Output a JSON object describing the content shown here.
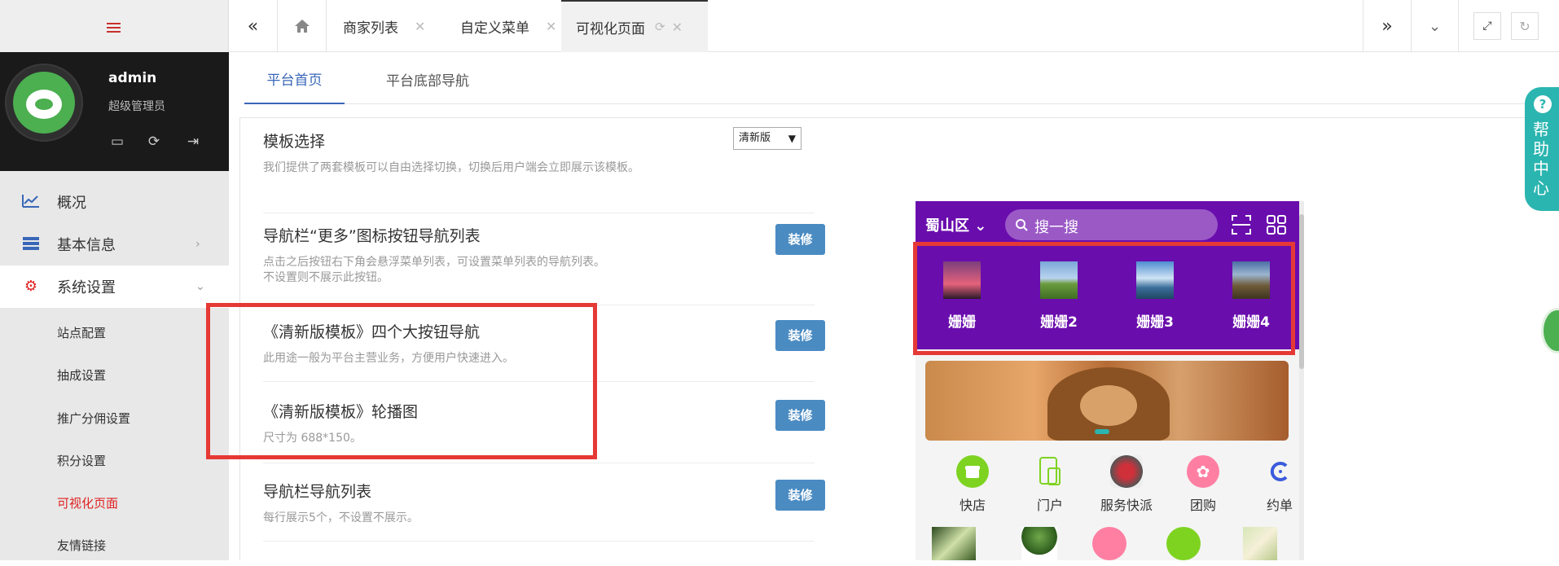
{
  "sidebar": {
    "user": {
      "name": "admin",
      "role": "超级管理员"
    },
    "nav": [
      {
        "label": "概况",
        "icon": "chart-line-icon"
      },
      {
        "label": "基本信息",
        "icon": "list-icon"
      },
      {
        "label": "系统设置",
        "icon": "gear-icon"
      }
    ],
    "sub": [
      {
        "label": "站点配置"
      },
      {
        "label": "抽成设置"
      },
      {
        "label": "推广分佣设置"
      },
      {
        "label": "积分设置"
      },
      {
        "label": "可视化页面"
      },
      {
        "label": "友情链接"
      }
    ]
  },
  "tabs": [
    {
      "label": "商家列表"
    },
    {
      "label": "自定义菜单"
    },
    {
      "label": "可视化页面"
    }
  ],
  "subtabs": [
    "平台首页",
    "平台底部导航"
  ],
  "template": {
    "title": "模板选择",
    "desc": "我们提供了两套模板可以自由选择切换，切换后用户端会立即展示该模板。",
    "select": "清新版"
  },
  "rows": [
    {
      "title": "导航栏“更多”图标按钮导航列表",
      "desc1": "点击之后按钮右下角会悬浮菜单列表，可设置菜单列表的导航列表。",
      "desc2": "不设置则不展示此按钮。",
      "button": "装修"
    },
    {
      "title": "《清新版模板》四个大按钮导航",
      "desc1": "此用途一般为平台主营业务，方便用户快速进入。",
      "button": "装修"
    },
    {
      "title": "《清新版模板》轮播图",
      "desc1": "尺寸为 688*150。",
      "button": "装修"
    },
    {
      "title": "导航栏导航列表",
      "desc1": "每行展示5个，不设置不展示。",
      "button": "装修"
    }
  ],
  "phone": {
    "location": "蜀山区",
    "search": "搜一搜",
    "nav": [
      "姗姗",
      "姗姗2",
      "姗姗3",
      "姗姗4"
    ],
    "icons": [
      "快店",
      "门户",
      "服务快派",
      "团购",
      "约单"
    ]
  },
  "help": {
    "text": "帮助中心"
  },
  "colors": {
    "accent": "#3967b8",
    "active_red": "#e02020",
    "phone_purple": "#6a0dad",
    "button_blue": "#4a8bc2",
    "highlight": "#e53935"
  }
}
